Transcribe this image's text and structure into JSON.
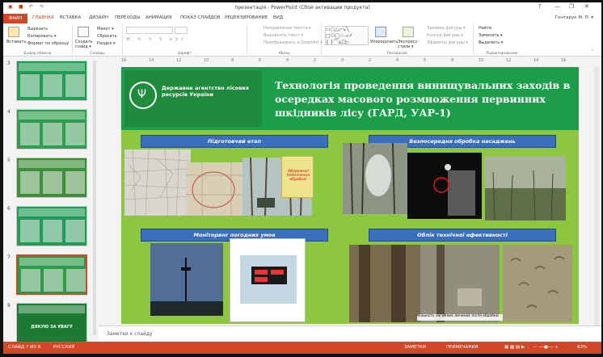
{
  "titlebar": {
    "title": "презентація - PowerPoint (Сбой активации продукта)",
    "help": "?",
    "minimize": "—",
    "restore": "❐",
    "close": "✕"
  },
  "tabs": {
    "file": "ФАЙЛ",
    "items": [
      "ГЛАВНАЯ",
      "ВСТАВКА",
      "ДИЗАЙН",
      "ПЕРЕХОДЫ",
      "АНИМАЦИЯ",
      "ПОКАЗ СЛАЙДОВ",
      "РЕЦЕНЗИРОВАНИЕ",
      "ВИД"
    ],
    "user": "Гонтарук М. П. ▾"
  },
  "ribbon": {
    "clipboard": {
      "paste": "Вставить",
      "cut": "Вырезать",
      "copy": "Копировать ▾",
      "format": "Формат по образцу",
      "label": "Буфер обмена"
    },
    "slides": {
      "create": "Создать слайд ▾",
      "layout": "Макет ▾",
      "reset": "Сбросить",
      "section": "Раздел ▾",
      "label": "Слайды"
    },
    "font": {
      "label": "Шрифт"
    },
    "paragraph": {
      "direction": "Направление текста ▾",
      "align": "Выровнять текст ▾",
      "smartart": "Преобразовать в SmartArt ▾",
      "label": "Абзац"
    },
    "drawing": {
      "arrange": "Упорядочить",
      "styles": "Экспресс-стили ▾",
      "fill": "Заливка фигуры ▾",
      "outline": "Контур фигуры ▾",
      "effects": "Эффекты фигуры ▾",
      "label": "Рисование"
    },
    "editing": {
      "find": "Найти",
      "replace": "Заменить ▾",
      "select": "Выделить ▾",
      "label": "Редактирование"
    }
  },
  "ruler": [
    "16",
    "14",
    "12",
    "10",
    "8",
    "6",
    "4",
    "2",
    "0",
    "2",
    "4",
    "6",
    "8",
    "10",
    "12",
    "14",
    "16"
  ],
  "thumbnails": [
    {
      "num": "3",
      "color": "#1f9d55"
    },
    {
      "num": "4",
      "color": "#2e9e4f"
    },
    {
      "num": "5",
      "color": "#3f8f3a"
    },
    {
      "num": "6",
      "color": "#219b58"
    },
    {
      "num": "7",
      "color": "#2c9a48"
    },
    {
      "num": "8",
      "color": "#1d7a33",
      "text": "ДЯКУЮ ЗА УВАГУ"
    }
  ],
  "slide": {
    "logo_text": "Державне агентство лісових ресурсів України",
    "title": "Технологія проведення винищувальних заходів в осередках масового розмноження первинних шкідників лісу (ГАРД, УАР-1)",
    "bands": {
      "prep": "Підготовчий етап",
      "direct": "Безпосередня обробка насаджень",
      "weather": "Моніторинг погодних умов",
      "efficiency": "Облік технічної ефективності"
    },
    "photo_caption": "Кількість загиблих личинок після обробки",
    "sign_text": "Обережно! Небезпечна обробка!"
  },
  "notes": "Заметки к слайду",
  "status": {
    "slide": "СЛАЙД 7 ИЗ 8",
    "lang": "РУССКИЙ",
    "notes": "ЗАМЕТКИ",
    "comments": "ПРИМЕЧАНИЯ",
    "zoom": "63%"
  }
}
